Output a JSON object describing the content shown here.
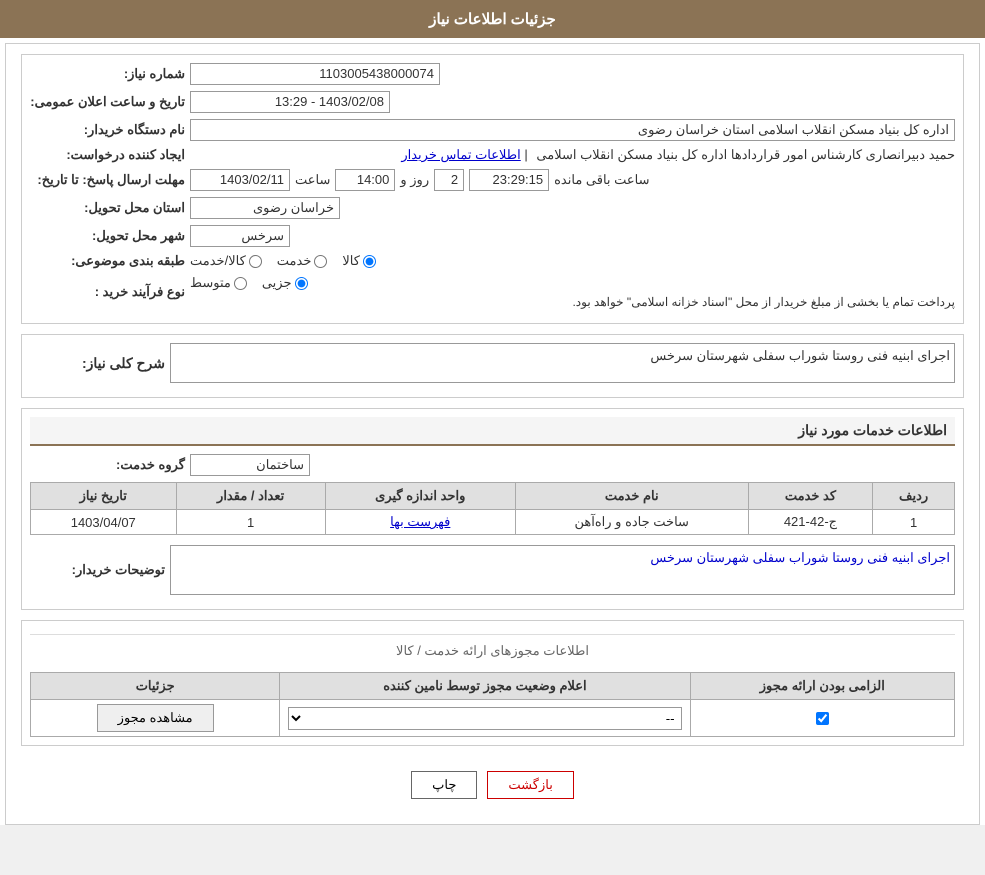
{
  "page": {
    "header": "جزئیات اطلاعات نیاز",
    "sections": {
      "basic_info": {
        "shomara_niaz_label": "شماره نیاز:",
        "shomara_niaz_value": "1103005438000074",
        "nam_dastgah_label": "نام دستگاه خریدار:",
        "nam_dastgah_value": "اداره کل بنیاد مسکن انقلاب اسلامی استان خراسان رضوی",
        "ijad_label": "ایجاد کننده درخواست:",
        "ijad_value": "حمید دبیرانصاری کارشناس امور قراردادها اداره کل بنیاد مسکن انقلاب اسلامی",
        "ijad_link": "اطلاعات تماس خریدار",
        "mohlat_label": "مهلت ارسال پاسخ: تا تاریخ:",
        "tarikh_label": "تاریخ و ساعت اعلان عمومی:",
        "tarikh_value": "1403/02/08 - 13:29",
        "date1": "1403/02/11",
        "saaat_label": "ساعت",
        "saaat_value": "14:00",
        "rooz_label": "روز و",
        "rooz_value": "2",
        "baqi_label": "ساعت باقی مانده",
        "baqi_value": "23:29:15",
        "ostan_label": "استان محل تحویل:",
        "ostan_value": "خراسان رضوی",
        "shahr_label": "شهر محل تحویل:",
        "shahr_value": "سرخس",
        "tabaqe_label": "طبقه بندی موضوعی:",
        "tabaqe_kala": "کالا",
        "tabaqe_khadamat": "خدمت",
        "tabaqe_kala_khadamat": "کالا/خدمت",
        "nooe_label": "نوع فرآیند خرید :",
        "nooe_jazii": "جزیی",
        "nooe_motavaset": "متوسط",
        "nooe_note": "پرداخت تمام یا بخشی از مبلغ خریدار از محل \"اسناد خزانه اسلامی\" خواهد بود."
      },
      "sharh": {
        "title": "شرح کلی نیاز:",
        "value": "اجرای ابنیه فنی روستا شوراب سفلی شهرستان سرخس"
      },
      "khadamat": {
        "title": "اطلاعات خدمات مورد نیاز",
        "grooh_label": "گروه خدمت:",
        "grooh_value": "ساختمان"
      },
      "table": {
        "headers": [
          "ردیف",
          "کد خدمت",
          "نام خدمت",
          "واحد اندازه گیری",
          "تعداد / مقدار",
          "تاریخ نیاز"
        ],
        "rows": [
          {
            "radif": "1",
            "kod": "ج-42-421",
            "nam": "ساخت جاده و راه‌آهن",
            "vahed": "فهرست بها",
            "tedad": "1",
            "tarikh": "1403/04/07"
          }
        ]
      },
      "tozihat": {
        "label": "توضیحات خریدار:",
        "value": "اجرای ابنیه فنی روستا شوراب سفلی شهرستان سرخس"
      },
      "mojooz": {
        "divider_title": "اطلاعات مجوزهای ارائه خدمت / کالا",
        "table_headers": [
          "الزامی بودن ارائه مجوز",
          "اعلام وضعیت مجوز توسط نامین کننده",
          "جزئیات"
        ],
        "rows": [
          {
            "elzami": true,
            "vaziat": "--",
            "joziyat_label": "مشاهده مجوز"
          }
        ]
      }
    },
    "buttons": {
      "print": "چاپ",
      "back": "بازگشت"
    }
  }
}
